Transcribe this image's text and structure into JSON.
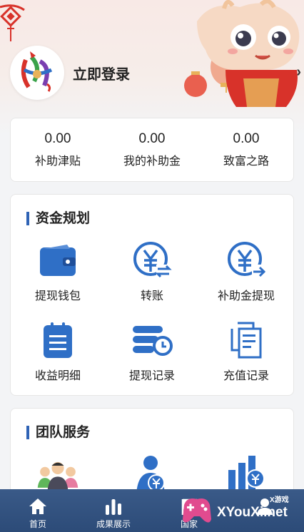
{
  "header": {
    "login_label": "立即登录",
    "chevron": "›"
  },
  "stats": [
    {
      "value": "0.00",
      "label": "补助津贴"
    },
    {
      "value": "0.00",
      "label": "我的补助金"
    },
    {
      "value": "0.00",
      "label": "致富之路"
    }
  ],
  "fund_section": {
    "title": "资金规划",
    "items": [
      {
        "label": "提现钱包",
        "icon": "wallet-icon"
      },
      {
        "label": "转账",
        "icon": "transfer-icon"
      },
      {
        "label": "补助金提现",
        "icon": "withdraw-icon"
      },
      {
        "label": "收益明细",
        "icon": "clipboard-icon"
      },
      {
        "label": "提现记录",
        "icon": "record-clock-icon"
      },
      {
        "label": "充值记录",
        "icon": "document-copy-icon"
      }
    ]
  },
  "team_section": {
    "title": "团队服务",
    "items": [
      {
        "icon": "team-people-icon"
      },
      {
        "icon": "person-money-icon"
      },
      {
        "icon": "bar-chart-money-icon"
      }
    ]
  },
  "tabbar": {
    "tabs": [
      {
        "label": "首页",
        "icon": "home-icon"
      },
      {
        "label": "成果展示",
        "icon": "bars-icon"
      },
      {
        "label": "国家",
        "icon": "flag-icon"
      },
      {
        "label": "",
        "icon": "user-icon"
      }
    ]
  },
  "watermark": {
    "brand": "XYouXi.net",
    "small": "X游戏"
  },
  "colors": {
    "accent_blue": "#2f63b5",
    "icon_blue": "#2f6fc6",
    "tabbar": "#2c4b78"
  }
}
